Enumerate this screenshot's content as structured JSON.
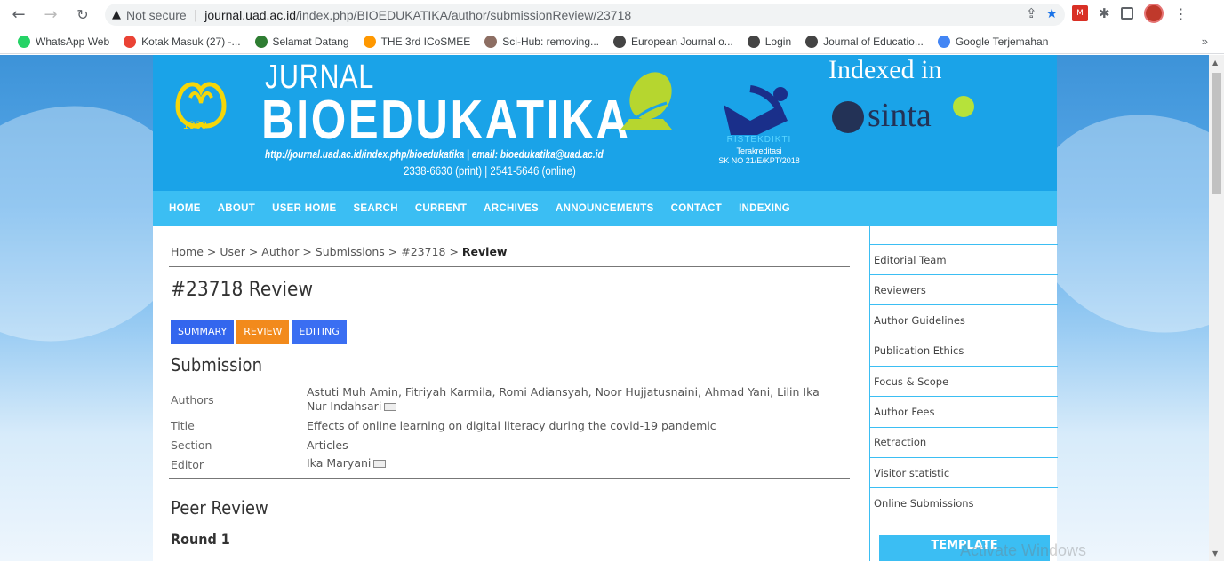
{
  "browser": {
    "not_secure": "Not secure",
    "url_host": "journal.uad.ac.id",
    "url_path": "/index.php/BIOEDUKATIKA/author/submissionReview/23718",
    "bookmarks": [
      {
        "label": "WhatsApp Web",
        "color": "#25d366"
      },
      {
        "label": "Kotak Masuk (27) -...",
        "color": "#ea4335"
      },
      {
        "label": "Selamat Datang",
        "color": "#2e7d32"
      },
      {
        "label": "THE 3rd ICoSMEE",
        "color": "#ff9800"
      },
      {
        "label": "Sci-Hub: removing...",
        "color": "#8d6e63"
      },
      {
        "label": "European Journal o...",
        "color": "#444"
      },
      {
        "label": "Login",
        "color": "#444"
      },
      {
        "label": "Journal of Educatio...",
        "color": "#444"
      },
      {
        "label": "Google Terjemahan",
        "color": "#4285f4"
      }
    ],
    "more": "»"
  },
  "banner": {
    "jurnal": "JURNAL",
    "bioedukatika": "BIOEDUKATIKA",
    "url_line": "http://journal.uad.ac.id/index.php/bioedukatika | email: bioedukatika@uad.ac.id",
    "issn": "2338-6630 (print) | 2541-5646 (online)",
    "logo_year": "1960",
    "ristek": "RISTEKDIKTI",
    "terakreditasi": "Terakreditasi",
    "sk": "SK NO 21/E/KPT/2018",
    "indexed_in": "Indexed in",
    "sinta": "sinta"
  },
  "menu": [
    "HOME",
    "ABOUT",
    "USER HOME",
    "SEARCH",
    "CURRENT",
    "ARCHIVES",
    "ANNOUNCEMENTS",
    "CONTACT",
    "INDEXING"
  ],
  "breadcrumb": {
    "home": "Home",
    "user": "User",
    "author": "Author",
    "submissions": "Submissions",
    "id": "#23718",
    "current": "Review",
    "sep": " > "
  },
  "page_title": "#23718 Review",
  "tabs": {
    "summary": "SUMMARY",
    "review": "REVIEW",
    "editing": "EDITING"
  },
  "submission": {
    "heading": "Submission",
    "authors_label": "Authors",
    "authors_value": "Astuti Muh Amin, Fitriyah Karmila, Romi Adiansyah, Noor Hujjatusnaini, Ahmad Yani, Lilin Ika Nur Indahsari",
    "title_label": "Title",
    "title_value": "Effects of online learning on digital literacy during the covid-19 pandemic",
    "section_label": "Section",
    "section_value": "Articles",
    "editor_label": "Editor",
    "editor_value": "Ika Maryani"
  },
  "peer_review": {
    "heading": "Peer Review",
    "round": "Round 1"
  },
  "sidebar": {
    "items": [
      "Editorial Team",
      "Reviewers",
      "Author Guidelines",
      "Publication Ethics",
      "Focus & Scope",
      "Author Fees",
      "Retraction",
      "Visitor statistic",
      "Online Submissions"
    ],
    "template_button": "TEMPLATE"
  },
  "watermark": "Activate Windows"
}
